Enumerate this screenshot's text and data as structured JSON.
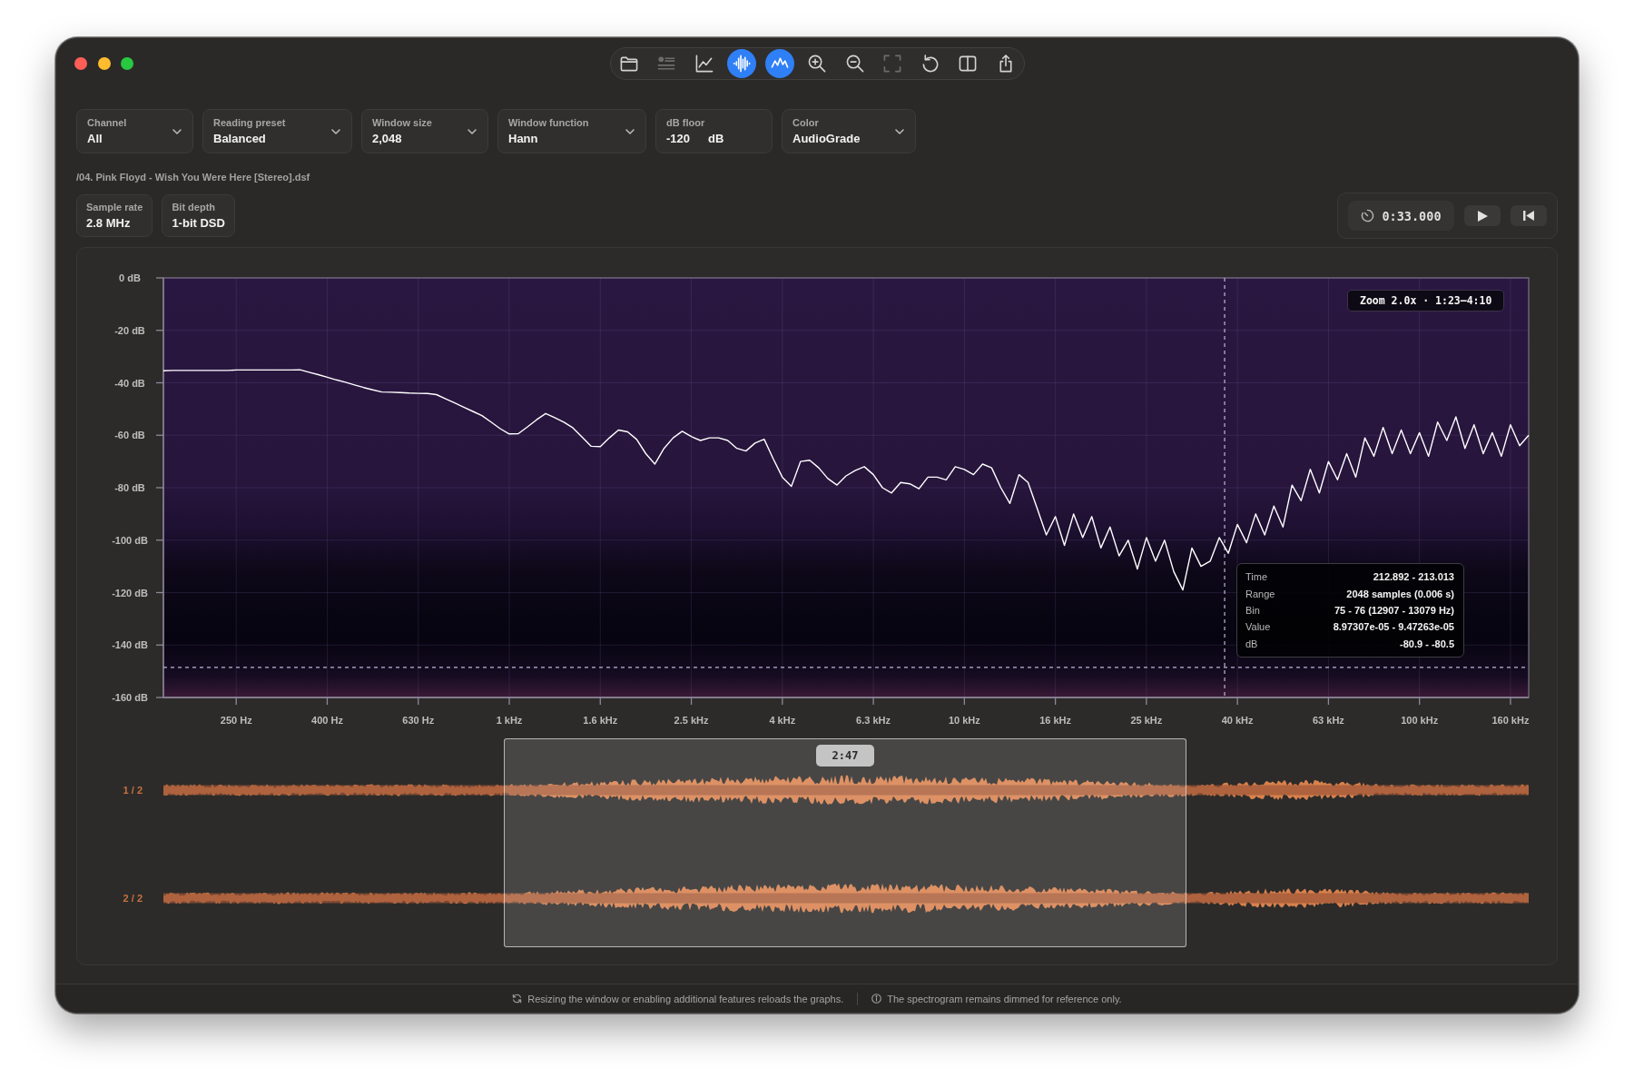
{
  "toolbar": [
    {
      "selected": false,
      "disabled": false
    },
    {
      "selected": false,
      "disabled": true
    },
    {
      "selected": false,
      "disabled": false
    },
    {
      "selected": true,
      "disabled": false
    },
    {
      "selected": true,
      "disabled": false
    },
    {
      "selected": false,
      "disabled": false
    },
    {
      "selected": false,
      "disabled": false
    },
    {
      "selected": false,
      "disabled": true
    },
    {
      "selected": false,
      "disabled": false
    },
    {
      "selected": false,
      "disabled": false
    },
    {
      "selected": false,
      "disabled": false
    }
  ],
  "controls": [
    {
      "kind": "select",
      "label": "Channel",
      "value": "All"
    },
    {
      "kind": "select",
      "label": "Reading preset",
      "value": "Balanced"
    },
    {
      "kind": "select",
      "label": "Window size",
      "value": "2,048"
    },
    {
      "kind": "select",
      "label": "Window function",
      "value": "Hann"
    },
    {
      "kind": "number",
      "label": "dB floor",
      "value": "-120",
      "unit": "dB"
    },
    {
      "kind": "select",
      "label": "Color",
      "value": "AudioGrade"
    }
  ],
  "file_path": "/04. Pink Floyd - Wish You Were Here [Stereo].dsf",
  "file_info": [
    {
      "label": "Sample rate",
      "value": "2.8 MHz"
    },
    {
      "label": "Bit depth",
      "value": "1-bit DSD"
    }
  ],
  "playback": {
    "time": "0:33.000"
  },
  "spectrum": {
    "zoom_label": "Zoom 2.0x · 1:23–4:10",
    "tooltip": [
      {
        "label": "Time",
        "value": "212.892 - 213.013"
      },
      {
        "label": "Range",
        "value": "2048 samples (0.006 s)"
      },
      {
        "label": "Bin",
        "value": "75 - 76 (12907 - 13079 Hz)"
      },
      {
        "label": "Value",
        "value": "8.97307e-05 - 9.47263e-05"
      },
      {
        "label": "dB",
        "value": "-80.9 - -80.5"
      }
    ],
    "chart_data": {
      "type": "line",
      "grid": true,
      "categories": [
        null,
        null,
        null,
        null,
        null,
        null,
        null,
        null,
        "250 Hz",
        null,
        null,
        null,
        null,
        null,
        null,
        null,
        null,
        null,
        "400 Hz",
        null,
        null,
        null,
        null,
        null,
        null,
        null,
        null,
        null,
        "630 Hz",
        null,
        null,
        null,
        null,
        null,
        null,
        null,
        null,
        null,
        "1 kHz",
        null,
        null,
        null,
        null,
        null,
        null,
        null,
        null,
        null,
        "1.6 kHz",
        null,
        null,
        null,
        null,
        null,
        null,
        null,
        null,
        null,
        "2.5 kHz",
        null,
        null,
        null,
        null,
        null,
        null,
        null,
        null,
        null,
        "4 kHz",
        null,
        null,
        null,
        null,
        null,
        null,
        null,
        null,
        null,
        "6.3 kHz",
        null,
        null,
        null,
        null,
        null,
        null,
        null,
        null,
        null,
        "10 kHz",
        null,
        null,
        null,
        null,
        null,
        null,
        null,
        null,
        null,
        "16 kHz",
        null,
        null,
        null,
        null,
        null,
        null,
        null,
        null,
        null,
        "25 kHz",
        null,
        null,
        null,
        null,
        null,
        null,
        null,
        null,
        null,
        "40 kHz",
        null,
        null,
        null,
        null,
        null,
        null,
        null,
        null,
        null,
        "63 kHz",
        null,
        null,
        null,
        null,
        null,
        null,
        null,
        null,
        null,
        "100 kHz",
        null,
        null,
        null,
        null,
        null,
        null,
        null,
        null,
        null,
        "160 kHz",
        null,
        null
      ],
      "series": [
        {
          "color": "#ffffff",
          "values": [
            -35.4,
            -35.3,
            -35.3,
            -35.3,
            -35.3,
            -35.3,
            -35.3,
            -35.3,
            -35.1,
            -35.1,
            -35.1,
            -35.1,
            -35.1,
            -35.1,
            -35.1,
            -35.0,
            -36.0,
            -36.9,
            -37.9,
            -38.9,
            -39.8,
            -40.8,
            -41.8,
            -42.7,
            -43.5,
            -43.6,
            -43.7,
            -43.9,
            -44.0,
            -44.1,
            -44.5,
            -46.1,
            -47.7,
            -49.3,
            -50.9,
            -52.5,
            -55.0,
            -57.5,
            -59.5,
            -59.4,
            -56.8,
            -54.1,
            -51.7,
            -53.3,
            -55.0,
            -57.2,
            -60.7,
            -64.2,
            -64.3,
            -61.0,
            -58.0,
            -58.7,
            -61.6,
            -67.0,
            -71.0,
            -65.0,
            -61.0,
            -58.5,
            -60.5,
            -62.0,
            -61.0,
            -61.0,
            -62.0,
            -65.0,
            -66.0,
            -63.0,
            -61.5,
            -69.0,
            -76.0,
            -79.5,
            -70.0,
            -69.5,
            -72.4,
            -76.5,
            -79.0,
            -75.5,
            -73.5,
            -72.0,
            -75.0,
            -80.0,
            -82.0,
            -78.0,
            -78.5,
            -80.4,
            -76.0,
            -76.0,
            -77.0,
            -72.0,
            -73.0,
            -75.0,
            -71.0,
            -72.4,
            -80.0,
            -86.0,
            -75.0,
            -78.0,
            -88,
            -98,
            -91,
            -102,
            -90,
            -99,
            -91,
            -103,
            -95,
            -106,
            -100,
            -111,
            -99,
            -108,
            -100,
            -112,
            -119,
            -103,
            -110,
            -108,
            -99,
            -105,
            -94,
            -101,
            -90,
            -98,
            -87,
            -95,
            -79,
            -85,
            -73,
            -82,
            -70,
            -77,
            -67,
            -76,
            -61,
            -68,
            -57,
            -67,
            -58,
            -67,
            -59,
            -68,
            -55,
            -62,
            -53,
            -65,
            -56,
            -67,
            -59,
            -68,
            -56,
            -64,
            -60
          ]
        }
      ],
      "ylim": [
        -160,
        0
      ],
      "yticks": [
        {
          "value": 0,
          "label": "0 dB"
        },
        {
          "value": -20,
          "label": "-20 dB"
        },
        {
          "value": -40,
          "label": "-40 dB"
        },
        {
          "value": -60,
          "label": "-60 dB"
        },
        {
          "value": -80,
          "label": "-80 dB"
        },
        {
          "value": -100,
          "label": "-100 dB"
        },
        {
          "value": -120,
          "label": "-120 dB"
        },
        {
          "value": -140,
          "label": "-140 dB"
        },
        {
          "value": -160,
          "label": "-160 dB"
        }
      ],
      "ref_lines": [
        {
          "axis": "y",
          "value": -148.5
        }
      ]
    }
  },
  "waveform": {
    "tracks": [
      {
        "label": "1 / 2"
      },
      {
        "label": "2 / 2"
      }
    ],
    "selection": {
      "label": "2:47"
    }
  },
  "status_bar": {
    "notes": [
      "Resizing the window or enabling additional features reloads the graphs.",
      "The spectrogram remains dimmed for reference only."
    ]
  }
}
